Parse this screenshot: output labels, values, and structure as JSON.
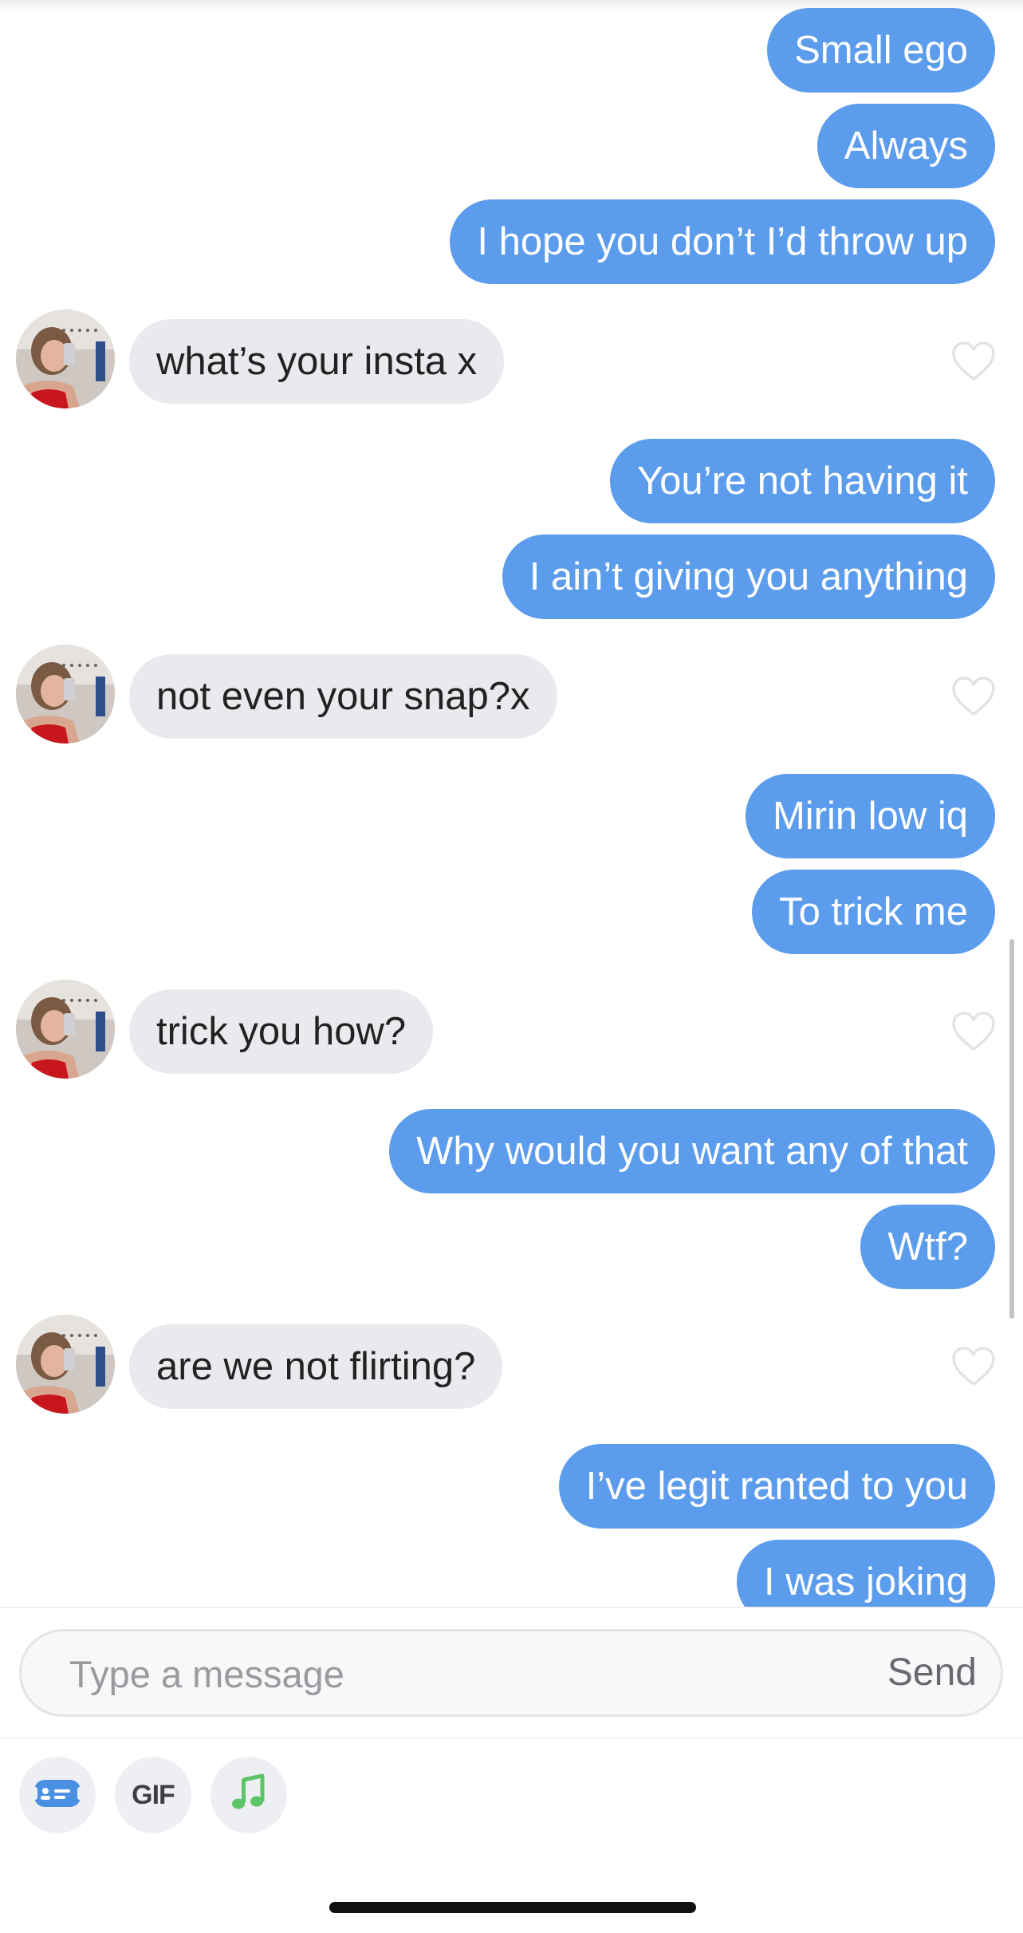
{
  "messages": [
    {
      "side": "out",
      "text": "Small ego"
    },
    {
      "side": "out",
      "text": "Always"
    },
    {
      "side": "out",
      "text": "I hope you don’t I’d throw up"
    },
    {
      "side": "in",
      "text": "what’s your insta x"
    },
    {
      "side": "out",
      "text": "You’re not having it"
    },
    {
      "side": "out",
      "text": "I ain’t giving you anything"
    },
    {
      "side": "in",
      "text": "not even your snap?x"
    },
    {
      "side": "out",
      "text": "Mirin low iq"
    },
    {
      "side": "out",
      "text": "To trick me"
    },
    {
      "side": "in",
      "text": "trick you how?"
    },
    {
      "side": "out",
      "text": "Why would you want any of that"
    },
    {
      "side": "out",
      "text": "Wtf?"
    },
    {
      "side": "in",
      "text": "are we not flirting?"
    },
    {
      "side": "out",
      "text": "I’ve legit ranted to you"
    },
    {
      "side": "out",
      "text": "I was joking"
    }
  ],
  "composer": {
    "placeholder": "Type a message",
    "send_label": "Send"
  },
  "toolbar": {
    "gif_label": "GIF",
    "icons": [
      "card-icon",
      "gif-icon",
      "music-note-icon"
    ]
  },
  "colors": {
    "outgoing_bubble": "#5c9cec",
    "incoming_bubble": "#e9eaee",
    "card_icon": "#4a90e2",
    "music_icon": "#5cc466"
  }
}
